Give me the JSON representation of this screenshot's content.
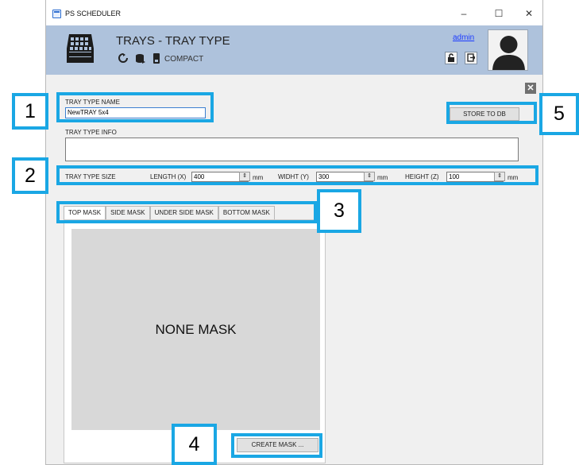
{
  "window": {
    "title": "PS SCHEDULER",
    "minimize": "–",
    "maximize": "☐",
    "close": "✕"
  },
  "header": {
    "title": "TRAYS - TRAY TYPE",
    "mode": "COMPACT",
    "user": "admin",
    "icons": [
      "refresh-icon",
      "database-icon",
      "device-icon"
    ],
    "buttons": [
      "unlock-icon",
      "logout-icon"
    ]
  },
  "form": {
    "name_label": "TRAY TYPE NAME",
    "name_value": "NewTRAY 5x4",
    "info_label": "TRAY TYPE INFO",
    "info_value": "",
    "store_label": "STORE TO DB",
    "size_label": "TRAY TYPE SIZE",
    "length": {
      "label": "LENGTH (X)",
      "value": "400",
      "unit": "mm"
    },
    "width": {
      "label": "WIDHT (Y)",
      "value": "300",
      "unit": "mm"
    },
    "height": {
      "label": "HEIGHT (Z)",
      "value": "100",
      "unit": "mm"
    }
  },
  "tabs": [
    "TOP MASK",
    "SIDE MASK",
    "UNDER SIDE MASK",
    "BOTTOM MASK"
  ],
  "mask": {
    "empty_text": "NONE MASK",
    "create_label": "CREATE MASK ..."
  },
  "callouts": [
    "1",
    "2",
    "3",
    "4",
    "5"
  ],
  "colors": {
    "header_bg": "#aec2dc",
    "callout": "#1aa7e4",
    "link": "#1b3aff"
  }
}
